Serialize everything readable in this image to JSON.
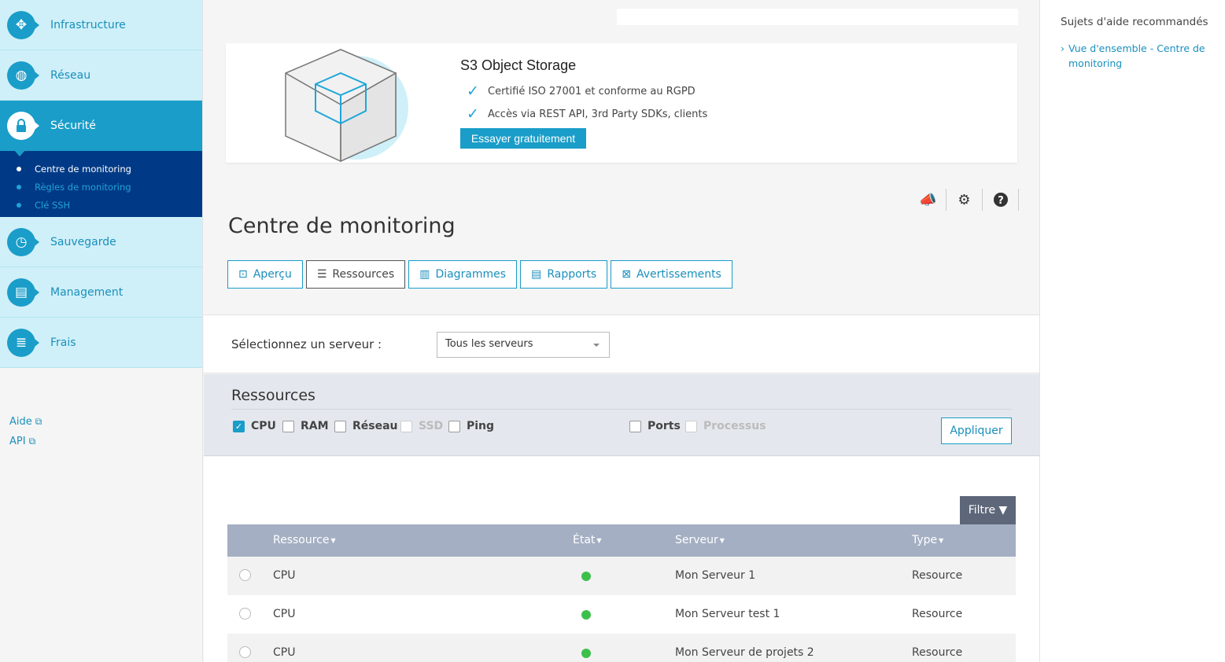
{
  "sidebar": {
    "items": [
      {
        "label": "Infrastructure",
        "icon": "infrastructure-icon",
        "glyph": "✥"
      },
      {
        "label": "Réseau",
        "icon": "network-globe-icon",
        "glyph": "◍"
      },
      {
        "label": "Sécurité",
        "icon": "lock-icon",
        "glyph": "🔒"
      },
      {
        "label": "Sauvegarde",
        "icon": "history-clock-icon",
        "glyph": "◷"
      },
      {
        "label": "Management",
        "icon": "clipboard-icon",
        "glyph": "▤"
      },
      {
        "label": "Frais",
        "icon": "coins-icon",
        "glyph": "≣"
      }
    ],
    "subitems": [
      "Centre de monitoring",
      "Règles de monitoring",
      "Clé SSH"
    ],
    "links": [
      "Aide",
      "API"
    ]
  },
  "help": {
    "title": "Sujets d'aide recommandés",
    "link": "Vue d'ensemble - Centre de monitoring"
  },
  "promo": {
    "title": "S3 Object Storage",
    "features": [
      "Certifié ISO 27001 et conforme au RGPD",
      "Accès via REST API, 3rd Party SDKs, clients"
    ],
    "button": "Essayer gratuitement"
  },
  "page_title": "Centre de monitoring",
  "tabs": [
    {
      "label": "Aperçu",
      "icon": "chart-monitor-icon",
      "glyph": "⊡"
    },
    {
      "label": "Ressources",
      "icon": "list-icon",
      "glyph": "☰"
    },
    {
      "label": "Diagrammes",
      "icon": "bar-chart-icon",
      "glyph": "▥"
    },
    {
      "label": "Rapports",
      "icon": "clipboard-icon",
      "glyph": "▤"
    },
    {
      "label": "Avertissements",
      "icon": "alert-monitor-icon",
      "glyph": "⊠"
    }
  ],
  "active_tab": "Ressources",
  "server_select": {
    "label": "Sélectionnez un serveur :",
    "value": "Tous les serveurs"
  },
  "resources": {
    "title": "Ressources",
    "options": [
      {
        "label": "CPU",
        "checked": true,
        "disabled": false
      },
      {
        "label": "RAM",
        "checked": false,
        "disabled": false
      },
      {
        "label": "Réseau",
        "checked": false,
        "disabled": false
      },
      {
        "label": "SSD",
        "checked": false,
        "disabled": true
      },
      {
        "label": "Ping",
        "checked": false,
        "disabled": false
      },
      {
        "label": "Ports",
        "checked": false,
        "disabled": false
      },
      {
        "label": "Processus",
        "checked": false,
        "disabled": true
      }
    ],
    "apply": "Appliquer"
  },
  "table": {
    "filter": "Filtre",
    "columns": [
      "Ressource",
      "État",
      "Serveur",
      "Type"
    ],
    "rows": [
      {
        "resource": "CPU",
        "status": "ok",
        "server": "Mon Serveur 1",
        "type": "Resource"
      },
      {
        "resource": "CPU",
        "status": "ok",
        "server": "Mon Serveur test 1",
        "type": "Resource"
      },
      {
        "resource": "CPU",
        "status": "ok",
        "server": "Mon Serveur de projets 2",
        "type": "Resource"
      }
    ]
  },
  "colors": {
    "accent": "#1a9dc9",
    "nav_bg": "#cff0f8",
    "subnav_bg": "#003a86",
    "status_ok": "#3cc04b",
    "table_header": "#a4afc3"
  }
}
